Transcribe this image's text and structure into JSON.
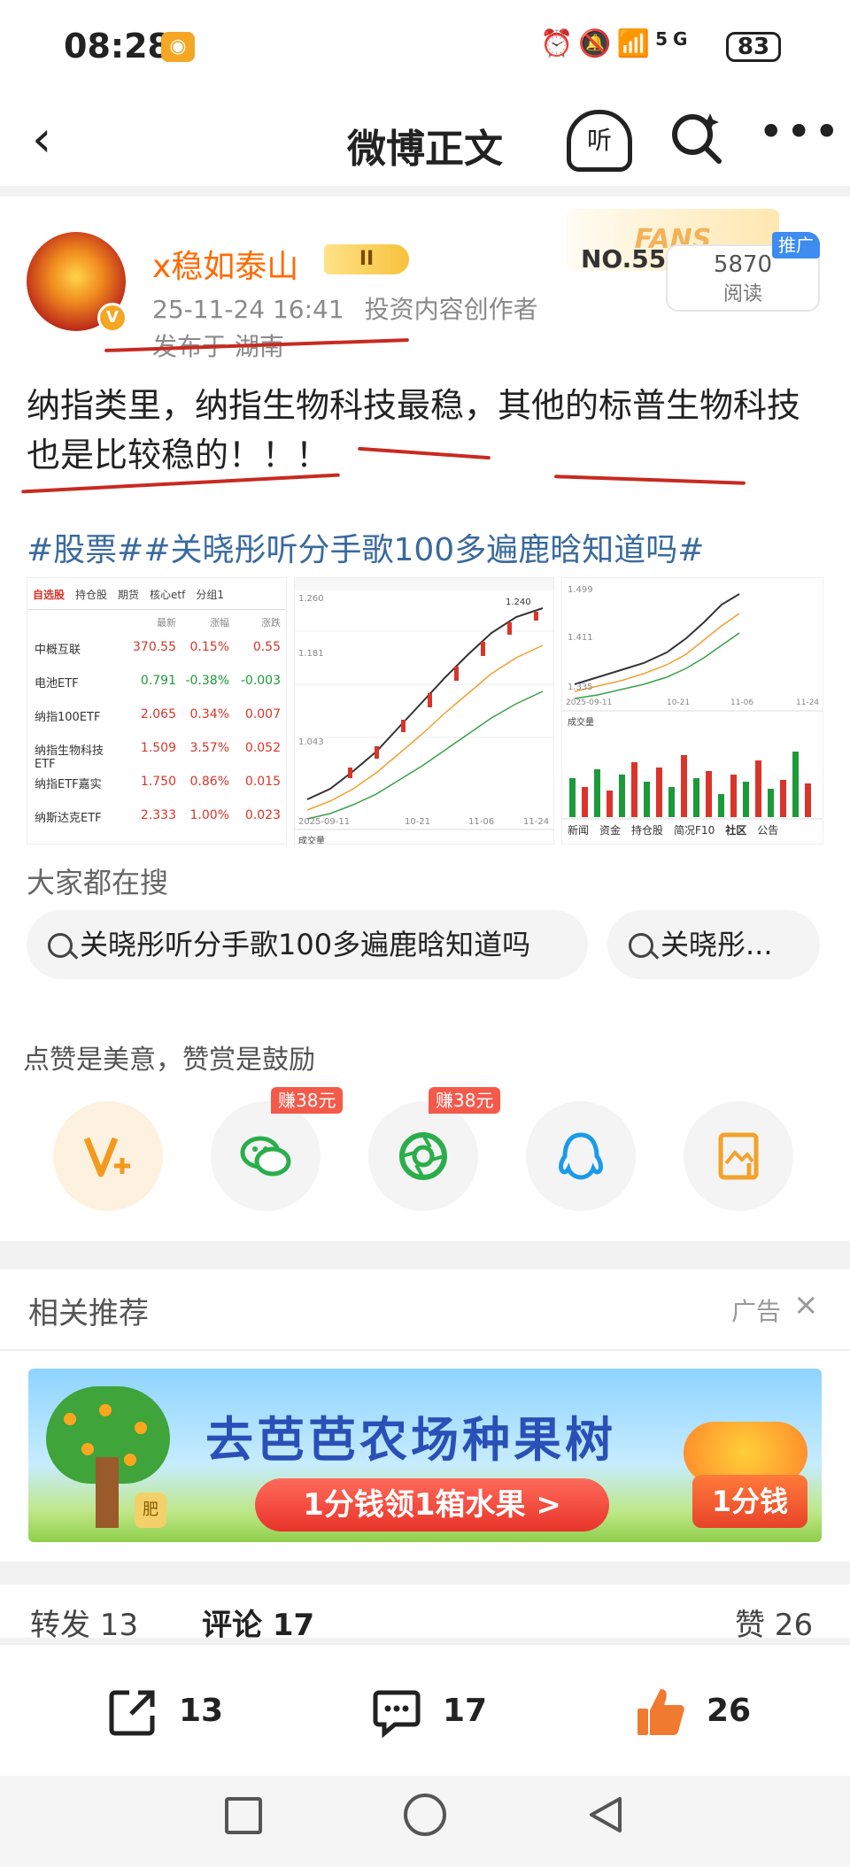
{
  "status_bar": {
    "time": "08:28",
    "network": "5G",
    "battery": "83"
  },
  "navbar": {
    "back_label": "‹",
    "title": "微博正文",
    "listen_label": "听"
  },
  "post": {
    "username": "x稳如泰山",
    "level": "II",
    "timestamp": "25-11-24 16:41",
    "author_tag": "投资内容创作者",
    "location": "发布于 湖南",
    "fans_banner": "FANS",
    "fans_no": "NO.5536",
    "read_count": "5870",
    "read_label": "阅读",
    "promo_tag": "推广",
    "text": "纳指类里，纳指生物科技最稳，其他的标普生物科技也是比较稳的！！！",
    "hashtags": "#股票##关晓彤听分手歌100多遍鹿晗知道吗#",
    "image_watchlist": {
      "tabs": [
        "自选股",
        "持仓股",
        "期货",
        "核心etf",
        "分组1"
      ],
      "headers": [
        "最新",
        "涨幅",
        "涨跌"
      ],
      "rows": [
        {
          "name": "中概互联",
          "price": "370.55",
          "change": "0.15%",
          "amount": "0.55",
          "dir": "up"
        },
        {
          "name": "电池ETF",
          "price": "0.791",
          "change": "-0.38%",
          "amount": "-0.003",
          "dir": "down"
        },
        {
          "name": "纳指100ETF",
          "price": "2.065",
          "change": "0.34%",
          "amount": "0.007",
          "dir": "up"
        },
        {
          "name": "纳指生物科技ETF",
          "price": "1.509",
          "change": "3.57%",
          "amount": "0.052",
          "dir": "up"
        },
        {
          "name": "纳指ETF嘉实",
          "price": "1.750",
          "change": "0.86%",
          "amount": "0.015",
          "dir": "up"
        },
        {
          "name": "纳斯达克ETF",
          "price": "2.333",
          "change": "1.00%",
          "amount": "0.023",
          "dir": "up"
        }
      ]
    },
    "image_chart_1": {
      "y_top": "1.260",
      "y_mid": "1.181",
      "y_low": "1.043",
      "value": "1.240",
      "x_start": "2025-09-11",
      "x_mid": "10-21",
      "x_end": "11-06",
      "x_last": "11-24",
      "footer": "成交量"
    },
    "image_chart_2": {
      "y_top": "1.499",
      "y_mid": "1.411",
      "y_low": "1.335",
      "x_start": "2025-09-11",
      "x_mid": "10-21",
      "x_end": "11-06",
      "x_last": "11-24",
      "footer": "成交量",
      "tabs": [
        "新闻",
        "资金",
        "持仓股",
        "简况F10",
        "社区",
        "公告"
      ]
    }
  },
  "search": {
    "title": "大家都在搜",
    "pill_1": "关晓彤听分手歌100多遍鹿晗知道吗",
    "pill_2": "关晓彤..."
  },
  "reward": {
    "text": "点赞是美意，赞赏是鼓励",
    "earn_1": "赚38元",
    "earn_2": "赚38元"
  },
  "recommend": {
    "title": "相关推荐",
    "ad_label": "广告",
    "ad_close": "×",
    "ad_headline": "去芭芭农场种果树",
    "ad_cta": "1分钱领1箱水果 >",
    "ad_price": "1分钱",
    "ad_badge": "肥"
  },
  "tabs": {
    "forward": "转发 13",
    "comment": "评论 17",
    "like": "赞 26"
  },
  "bottom_bar": {
    "forward_count": "13",
    "comment_count": "17",
    "like_count": "26"
  },
  "colors": {
    "accent_orange": "#ff6a00",
    "link_blue": "#3a6a9e",
    "rise_red": "#d9352a",
    "fall_green": "#1c9a3a",
    "underline_red": "#c82a20"
  }
}
